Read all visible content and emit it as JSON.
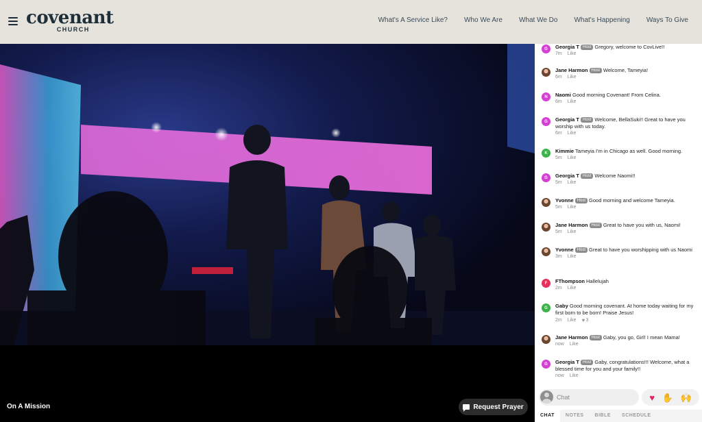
{
  "header": {
    "logo_main": "covenant",
    "logo_sub": "CHURCH",
    "nav": [
      "What's A Service Like?",
      "Who We Are",
      "What We Do",
      "What's Happening",
      "Ways To Give"
    ]
  },
  "stage": {
    "title": "On A Mission",
    "prayer_button": "Request Prayer"
  },
  "chat": {
    "host_label": "Host",
    "like_label": "Like",
    "messages": [
      {
        "initial": "G",
        "name": "Georgia T",
        "host": true,
        "text": "Gregory, welcome to CovLive!!",
        "time": "7m",
        "color": "#d63fd3"
      },
      {
        "initial": "",
        "name": "Jane Harmon",
        "host": true,
        "text": "Welcome, Tameyia!",
        "time": "6m",
        "color": "#8a5a3c"
      },
      {
        "initial": "N",
        "name": "Naomi",
        "host": false,
        "text": "Good morning Covenant! From Celina.",
        "time": "6m",
        "color": "#d63fd3"
      },
      {
        "initial": "G",
        "name": "Georgia T",
        "host": true,
        "text": "Welcome, BellaSuki!! Great to have you worship with us today.",
        "time": "6m",
        "color": "#d63fd3"
      },
      {
        "initial": "K",
        "name": "Kimmie",
        "host": false,
        "text": "Tameyia I'm in Chicago as well. Good morning.",
        "time": "5m",
        "color": "#3bb34a"
      },
      {
        "initial": "G",
        "name": "Georgia T",
        "host": true,
        "text": "Welcome Naomi!!",
        "time": "5m",
        "color": "#d63fd3"
      },
      {
        "initial": "",
        "name": "Yvonne",
        "host": true,
        "text": "Good morning and welcome Tameyia.",
        "time": "5m",
        "color": "#6b4530"
      },
      {
        "initial": "",
        "name": "Jane Harmon",
        "host": true,
        "text": "Great to have you with us, Naomi!",
        "time": "5m",
        "color": "#8a5a3c"
      },
      {
        "initial": "",
        "name": "Yvonne",
        "host": true,
        "text": "Great to have you worshipping with us Naomi",
        "time": "3m",
        "color": "#6b4530"
      },
      {
        "initial": "F",
        "name": "FThompson",
        "host": false,
        "text": "Hallelujah",
        "time": "2m",
        "color": "#e5305a"
      },
      {
        "initial": "G",
        "name": "Gaby",
        "host": false,
        "text": "Good morning covenant. At home today waiting for my first born to be born! Praise Jesus!",
        "time": "2m",
        "color": "#3bb34a",
        "hearts": "3"
      },
      {
        "initial": "",
        "name": "Jane Harmon",
        "host": true,
        "text": "Gaby, you go, Girl! I mean Mama!",
        "time": "now",
        "color": "#8a5a3c"
      },
      {
        "initial": "G",
        "name": "Georgia T",
        "host": true,
        "text": "Gaby, congratulations!!! Welcome, what a blessed time for you and your family!!",
        "time": "now",
        "color": "#d63fd3"
      }
    ],
    "input_placeholder": "Chat",
    "reactions": [
      "heart-icon",
      "clapping-hands-icon",
      "raised-hands-icon"
    ]
  },
  "tabs": [
    "CHAT",
    "NOTES",
    "BIBLE",
    "SCHEDULE"
  ],
  "active_tab": "CHAT"
}
